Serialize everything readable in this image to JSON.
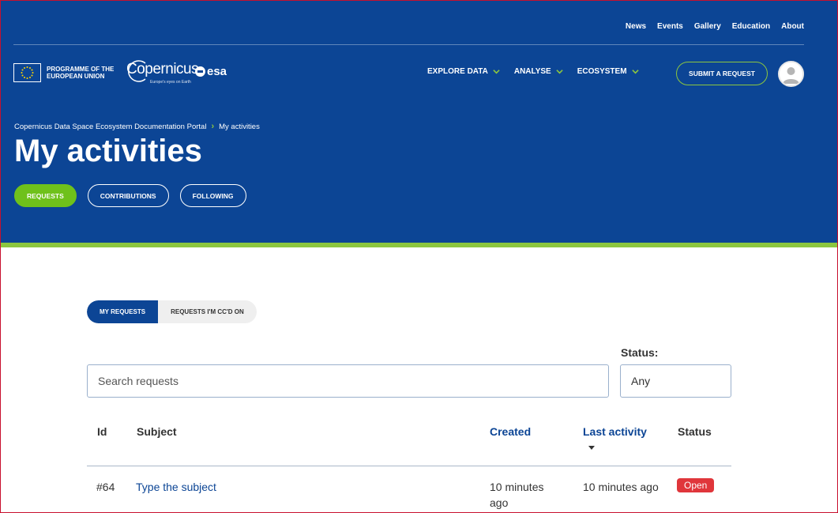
{
  "colors": {
    "brand_blue": "#0c4595",
    "accent_green": "#8cc63f",
    "active_tab_green": "#6fc11b",
    "status_open_red": "#e0363b"
  },
  "top_links": [
    "News",
    "Events",
    "Gallery",
    "Education",
    "About"
  ],
  "logos": {
    "eu_text": "PROGRAMME OF THE EUROPEAN UNION",
    "copernicus_word": "Copernicus",
    "copernicus_tagline": "Europe's eyes on Earth",
    "esa_word": "esa"
  },
  "main_nav": [
    "EXPLORE DATA",
    "ANALYSE",
    "ECOSYSTEM"
  ],
  "submit_button": "SUBMIT A REQUEST",
  "breadcrumb": {
    "root": "Copernicus Data Space Ecosystem Documentation Portal",
    "current": "My activities"
  },
  "page_title": "My activities",
  "tabs": [
    "REQUESTS",
    "CONTRIBUTIONS",
    "FOLLOWING"
  ],
  "segments": [
    "MY REQUESTS",
    "REQUESTS I'M CC'D ON"
  ],
  "filter": {
    "search_placeholder": "Search requests",
    "status_label": "Status:",
    "status_value": "Any"
  },
  "table": {
    "headers": [
      "Id",
      "Subject",
      "Created",
      "Last activity",
      "Status"
    ],
    "rows": [
      {
        "id": "#64",
        "subject": "Type the subject",
        "created": "10 minutes ago",
        "last_activity": "10 minutes ago",
        "status": "Open"
      }
    ]
  }
}
